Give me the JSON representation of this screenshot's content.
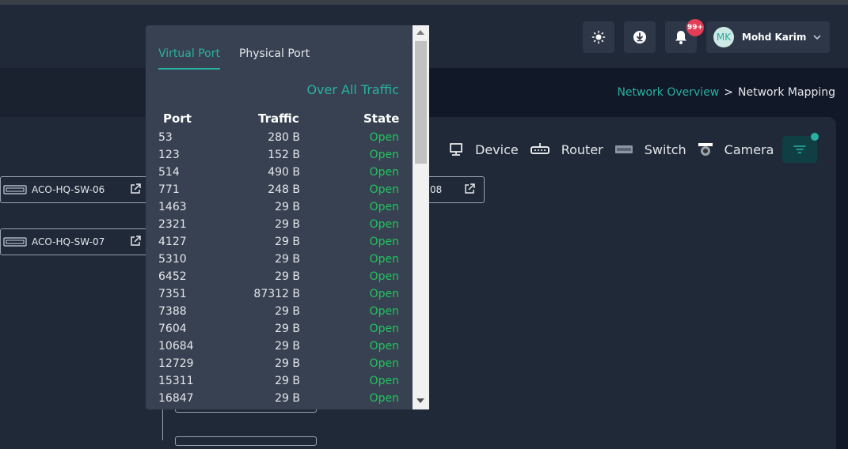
{
  "header": {
    "notification_badge": "99+",
    "user": {
      "initials": "MK",
      "name": "Mohd Karim"
    }
  },
  "breadcrumb": {
    "parent": "Network Overview",
    "separator": ">",
    "current": "Network Mapping"
  },
  "legend": [
    {
      "icon": "monitor-icon",
      "label": "Device"
    },
    {
      "icon": "router-icon",
      "label": "Router"
    },
    {
      "icon": "switch-icon",
      "label": "Switch"
    },
    {
      "icon": "camera-icon",
      "label": "Camera"
    }
  ],
  "nodes": {
    "sw06": "ACO-HQ-SW-06",
    "sw07": "ACO-HQ-SW-07",
    "sw08_partial": "08"
  },
  "popup": {
    "tabs": [
      "Virtual Port",
      "Physical Port"
    ],
    "active_tab": "Virtual Port",
    "over_all": "Over All Traffic",
    "columns": [
      "Port",
      "Traffic",
      "State"
    ],
    "rows": [
      {
        "port": "53",
        "traffic": "280 B",
        "state": "Open"
      },
      {
        "port": "123",
        "traffic": "152 B",
        "state": "Open"
      },
      {
        "port": "514",
        "traffic": "490 B",
        "state": "Open"
      },
      {
        "port": "771",
        "traffic": "248 B",
        "state": "Open"
      },
      {
        "port": "1463",
        "traffic": "29 B",
        "state": "Open"
      },
      {
        "port": "2321",
        "traffic": "29 B",
        "state": "Open"
      },
      {
        "port": "4127",
        "traffic": "29 B",
        "state": "Open"
      },
      {
        "port": "5310",
        "traffic": "29 B",
        "state": "Open"
      },
      {
        "port": "6452",
        "traffic": "29 B",
        "state": "Open"
      },
      {
        "port": "7351",
        "traffic": "87312 B",
        "state": "Open"
      },
      {
        "port": "7388",
        "traffic": "29 B",
        "state": "Open"
      },
      {
        "port": "7604",
        "traffic": "29 B",
        "state": "Open"
      },
      {
        "port": "10684",
        "traffic": "29 B",
        "state": "Open"
      },
      {
        "port": "12729",
        "traffic": "29 B",
        "state": "Open"
      },
      {
        "port": "15311",
        "traffic": "29 B",
        "state": "Open"
      },
      {
        "port": "16847",
        "traffic": "29 B",
        "state": "Open"
      }
    ]
  },
  "colors": {
    "accent": "#2ab0a2",
    "open_state": "#22c55e",
    "badge": "#e23c56"
  }
}
